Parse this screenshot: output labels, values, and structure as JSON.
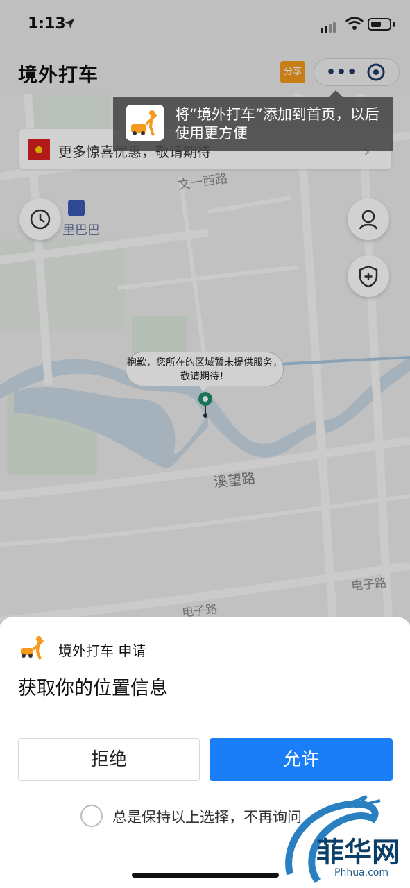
{
  "status_bar": {
    "time": "1:13"
  },
  "nav": {
    "title": "境外打车",
    "share_label": "分享",
    "more_label": "•••"
  },
  "tooltip": {
    "text": "将“境外打车”添加到首页，以后使用更方便"
  },
  "promo": {
    "text": "更多惊喜优惠，敬请期待"
  },
  "map": {
    "road_labels": [
      "文一西路",
      "溪望路",
      "电子路",
      "电子路"
    ],
    "poi_label": "里巴巴",
    "callout": "抱歉，您所在的区域暂未提供服务，敬请期待！"
  },
  "permission_sheet": {
    "app_name": "境外打车 申请",
    "title": "获取你的位置信息",
    "deny_label": "拒绝",
    "allow_label": "允许",
    "remember_label": "总是保持以上选择，不再询问"
  },
  "watermark": {
    "text": "菲华网",
    "sub": "Phhua.com"
  },
  "colors": {
    "accent": "#1a7ef6",
    "share": "#f39a1d",
    "pin": "#1a8f6a"
  }
}
